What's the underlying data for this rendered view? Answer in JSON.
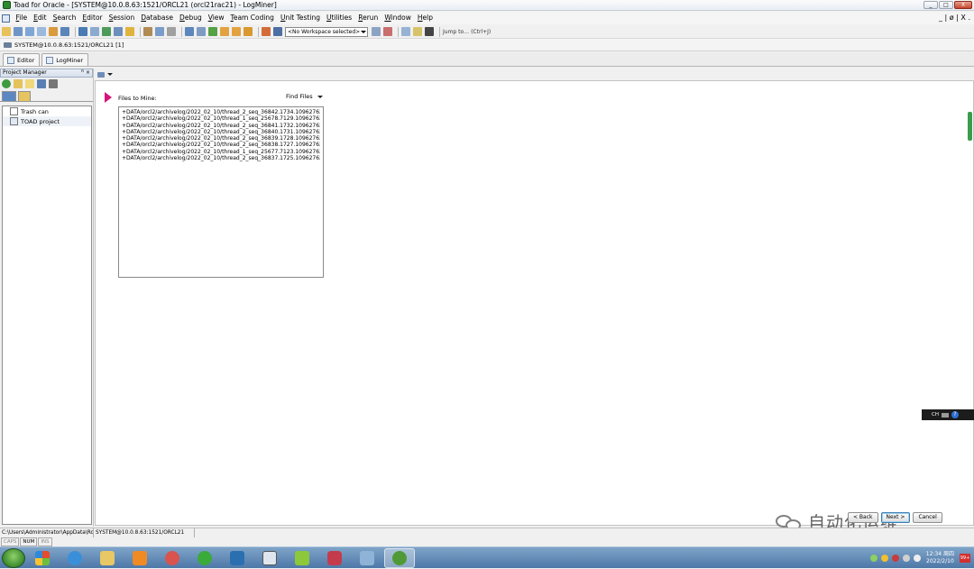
{
  "window": {
    "title": "Toad for Oracle - [SYSTEM@10.0.8.63:1521/ORCL21 (orcl21rac21) - LogMiner]",
    "controls": [
      "_",
      "□",
      "X"
    ],
    "mdi_controls": "_ | ø | X ."
  },
  "menu": {
    "items": [
      "File",
      "Edit",
      "Search",
      "Editor",
      "Session",
      "Database",
      "Debug",
      "View",
      "Team Coding",
      "Unit Testing",
      "Utilities",
      "Rerun",
      "Window",
      "Help"
    ]
  },
  "toolbar": {
    "workspace_select": "<No Workspace selected>",
    "jump_placeholder": "Jump to… (Ctrl+J)"
  },
  "connection": {
    "label": "SYSTEM@10.0.8.63:1521/ORCL21 [1]"
  },
  "tabs": [
    {
      "label": "Editor",
      "icon": "editor-icon"
    },
    {
      "label": "LogMiner",
      "icon": "logminer-icon"
    }
  ],
  "project_manager": {
    "title": "Project Manager",
    "pin": "ꟸ ×",
    "tree": [
      {
        "label": "Trash can",
        "icon": "trash-can-icon"
      },
      {
        "label": "TOAD project",
        "icon": "project-icon"
      }
    ]
  },
  "logminer": {
    "files_label": "Files to Mine:",
    "find_files_label": "Find Files",
    "files": [
      "+DATA/orcl2/archivelog/2022_02_10/thread_2_seq_36842.1734.1096276271",
      "+DATA/orcl2/archivelog/2022_02_10/thread_1_seq_25678.7129.1096276269",
      "+DATA/orcl2/archivelog/2022_02_10/thread_2_seq_36841.1732.1096276267",
      "+DATA/orcl2/archivelog/2022_02_10/thread_2_seq_36840.1731.1096276265",
      "+DATA/orcl2/archivelog/2022_02_10/thread_2_seq_36839.1728.1096276261",
      "+DATA/orcl2/archivelog/2022_02_10/thread_2_seq_36838.1727.1096276259",
      "+DATA/orcl2/archivelog/2022_02_10/thread_1_seq_25677.7123.1096276257",
      "+DATA/orcl2/archivelog/2022_02_10/thread_2_seq_36837.1725.1096276255"
    ]
  },
  "wizard_buttons": {
    "back": "< Back",
    "next": "Next >",
    "cancel": "Cancel"
  },
  "watermark": {
    "text": "自动化运维"
  },
  "ime": {
    "lang": "CH"
  },
  "status": {
    "path": "C:\\Users\\Administrator\\AppData\\Ro",
    "connection": "SYSTEM@10.0.8.63:1521/ORCL21",
    "keys": [
      {
        "label": "CAPS",
        "on": false
      },
      {
        "label": "NUM",
        "on": true
      },
      {
        "label": "INS",
        "on": false
      }
    ]
  },
  "taskbar": {
    "time": "12:34 周四",
    "date": "2022/2/10",
    "notification_badge": "99+"
  },
  "colors": {
    "accent_marker": "#d6157a",
    "taskbar": "#4e78a8",
    "green_scroll_tab": "#3a9c4c"
  }
}
